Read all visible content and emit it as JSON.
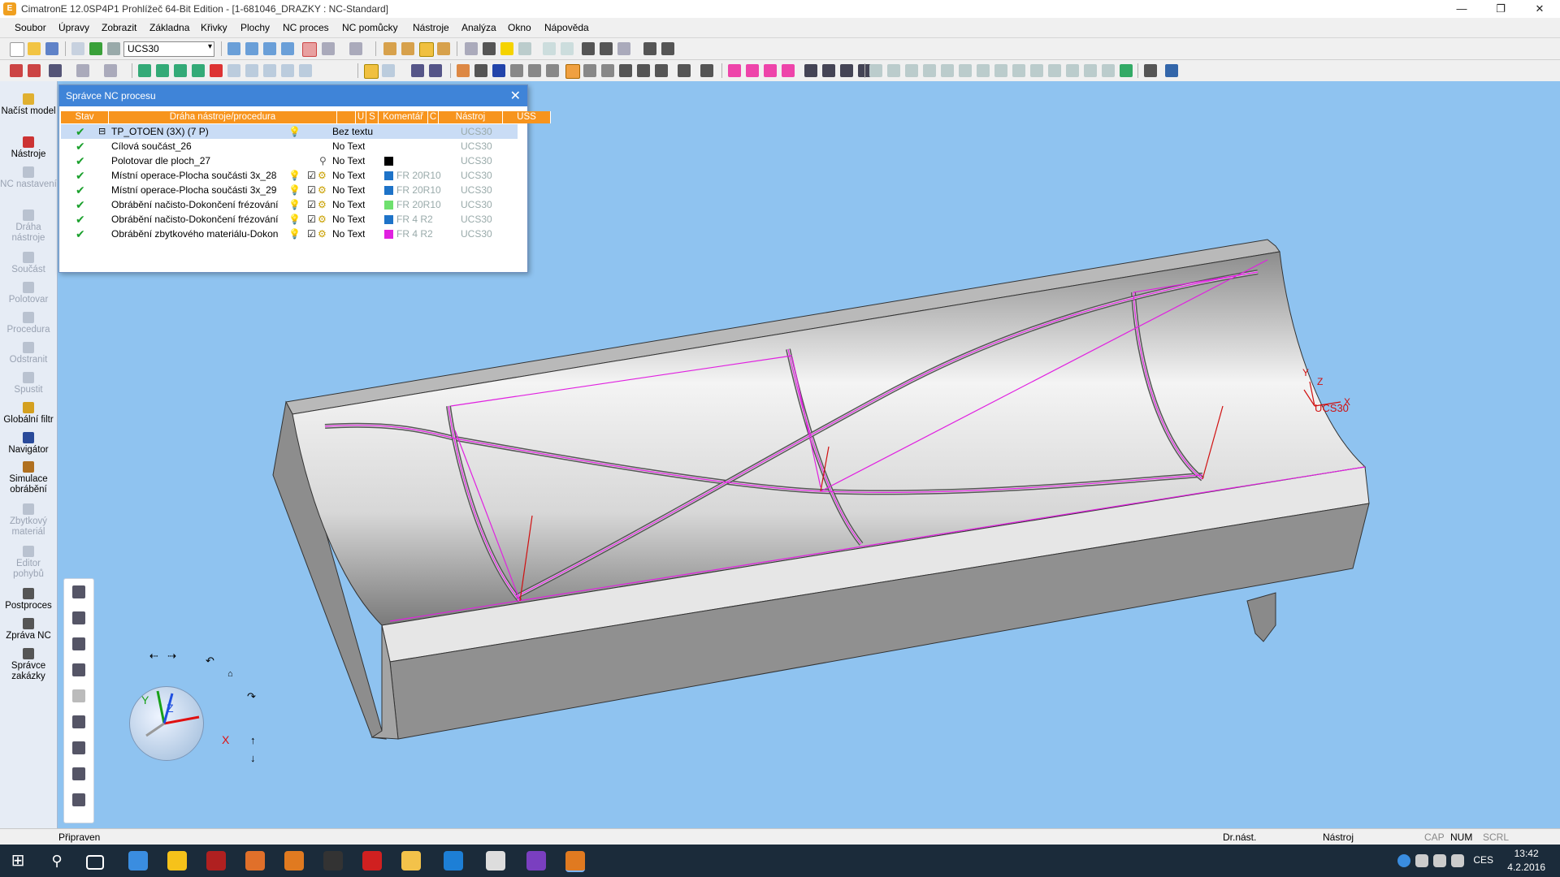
{
  "window": {
    "title": "CimatronE 12.0SP4P1  Prohlížeč 64-Bit Edition - [1-681046_DRAZKY : NC-Standard]",
    "minimize": "—",
    "restore": "❐",
    "close": "✕"
  },
  "menu": [
    "Soubor",
    "Úpravy",
    "Zobrazit",
    "Základna",
    "Křivky",
    "Plochy",
    "NC proces",
    "NC pomůcky",
    "Nástroje",
    "Analýza",
    "Okno",
    "Nápověda"
  ],
  "toolbar": {
    "ucs_value": "UCS30"
  },
  "sidebar": {
    "items": [
      {
        "label": "Načíst model",
        "enabled": true
      },
      {
        "label": "Nástroje",
        "enabled": true
      },
      {
        "label": "NC nastavení",
        "enabled": false
      },
      {
        "label": "Dráha nástroje",
        "enabled": false
      },
      {
        "label": "Součást",
        "enabled": false
      },
      {
        "label": "Polotovar",
        "enabled": false
      },
      {
        "label": "Procedura",
        "enabled": false
      },
      {
        "label": "Odstranit",
        "enabled": false
      },
      {
        "label": "Spustit",
        "enabled": false
      },
      {
        "label": "Globální filtr",
        "enabled": true
      },
      {
        "label": "Navigátor",
        "enabled": true
      },
      {
        "label": "Simulace obrábění",
        "enabled": true
      },
      {
        "label": "Zbytkový materiál",
        "enabled": false
      },
      {
        "label": "Editor pohybů",
        "enabled": false
      },
      {
        "label": "Postproces",
        "enabled": true
      },
      {
        "label": "Zpráva NC",
        "enabled": true
      },
      {
        "label": "Správce zakázky",
        "enabled": true
      }
    ]
  },
  "nc_manager": {
    "title": "Správce NC procesu",
    "close": "✕",
    "columns": [
      "Stav",
      "Dráha nástroje/procedura",
      "U",
      "S",
      "Komentář",
      "C",
      "Nástroj",
      "USS"
    ],
    "rows": [
      {
        "state": "✔",
        "name": "TP_OTOEN (3X) (7 P)",
        "expander": "⊟",
        "u": "",
        "s": "",
        "comment": "Bez textu",
        "color": "",
        "tool": "",
        "uss": "UCS30",
        "selected": true
      },
      {
        "state": "✔",
        "name": "Cílová součást_26",
        "expander": "",
        "u": "",
        "s": "",
        "comment": "No Text",
        "color": "",
        "tool": "",
        "uss": "UCS30",
        "selected": false
      },
      {
        "state": "✔",
        "name": "Polotovar dle ploch_27",
        "expander": "",
        "u": "",
        "s": "",
        "comment": "No Text",
        "color": "#000000",
        "tool": "",
        "uss": "UCS30",
        "selected": false
      },
      {
        "state": "✔",
        "name": "Místní operace-Plocha součásti 3x_28",
        "expander": "",
        "u": "☑",
        "s": "",
        "comment": "No Text",
        "color": "#1e73c8",
        "tool": "FR 20R10",
        "uss": "UCS30",
        "selected": false
      },
      {
        "state": "✔",
        "name": "Místní operace-Plocha součásti 3x_29",
        "expander": "",
        "u": "☑",
        "s": "",
        "comment": "No Text",
        "color": "#1e73c8",
        "tool": "FR 20R10",
        "uss": "UCS30",
        "selected": false
      },
      {
        "state": "✔",
        "name": "Obrábění načisto-Dokončení frézování",
        "expander": "",
        "u": "☑",
        "s": "",
        "comment": "No Text",
        "color": "#6ee06e",
        "tool": "FR 20R10",
        "uss": "UCS30",
        "selected": false
      },
      {
        "state": "✔",
        "name": "Obrábění načisto-Dokončení frézování",
        "expander": "",
        "u": "☑",
        "s": "",
        "comment": "No Text",
        "color": "#1e73c8",
        "tool": "FR 4 R2",
        "uss": "UCS30",
        "selected": false
      },
      {
        "state": "✔",
        "name": "Obrábění zbytkového materiálu-Dokon",
        "expander": "",
        "u": "☑",
        "s": "",
        "comment": "No Text",
        "color": "#e020e0",
        "tool": "FR 4 R2",
        "uss": "UCS30",
        "selected": false
      }
    ]
  },
  "viewport": {
    "ucs_label": "UCS30",
    "axis_x": "X",
    "axis_y": "Y",
    "axis_z": "Z",
    "gizmo_x": "X",
    "gizmo_y": "Y",
    "gizmo_z": "Z"
  },
  "statusbar": {
    "left": "Připraven",
    "dr_nast": "Dr.nást.",
    "nastroj": "Nástroj",
    "cap": "CAP",
    "num": "NUM",
    "scrl": "SCRL"
  },
  "taskbar": {
    "lang": "CES",
    "time": "13:42",
    "date": "4.2.2016"
  }
}
